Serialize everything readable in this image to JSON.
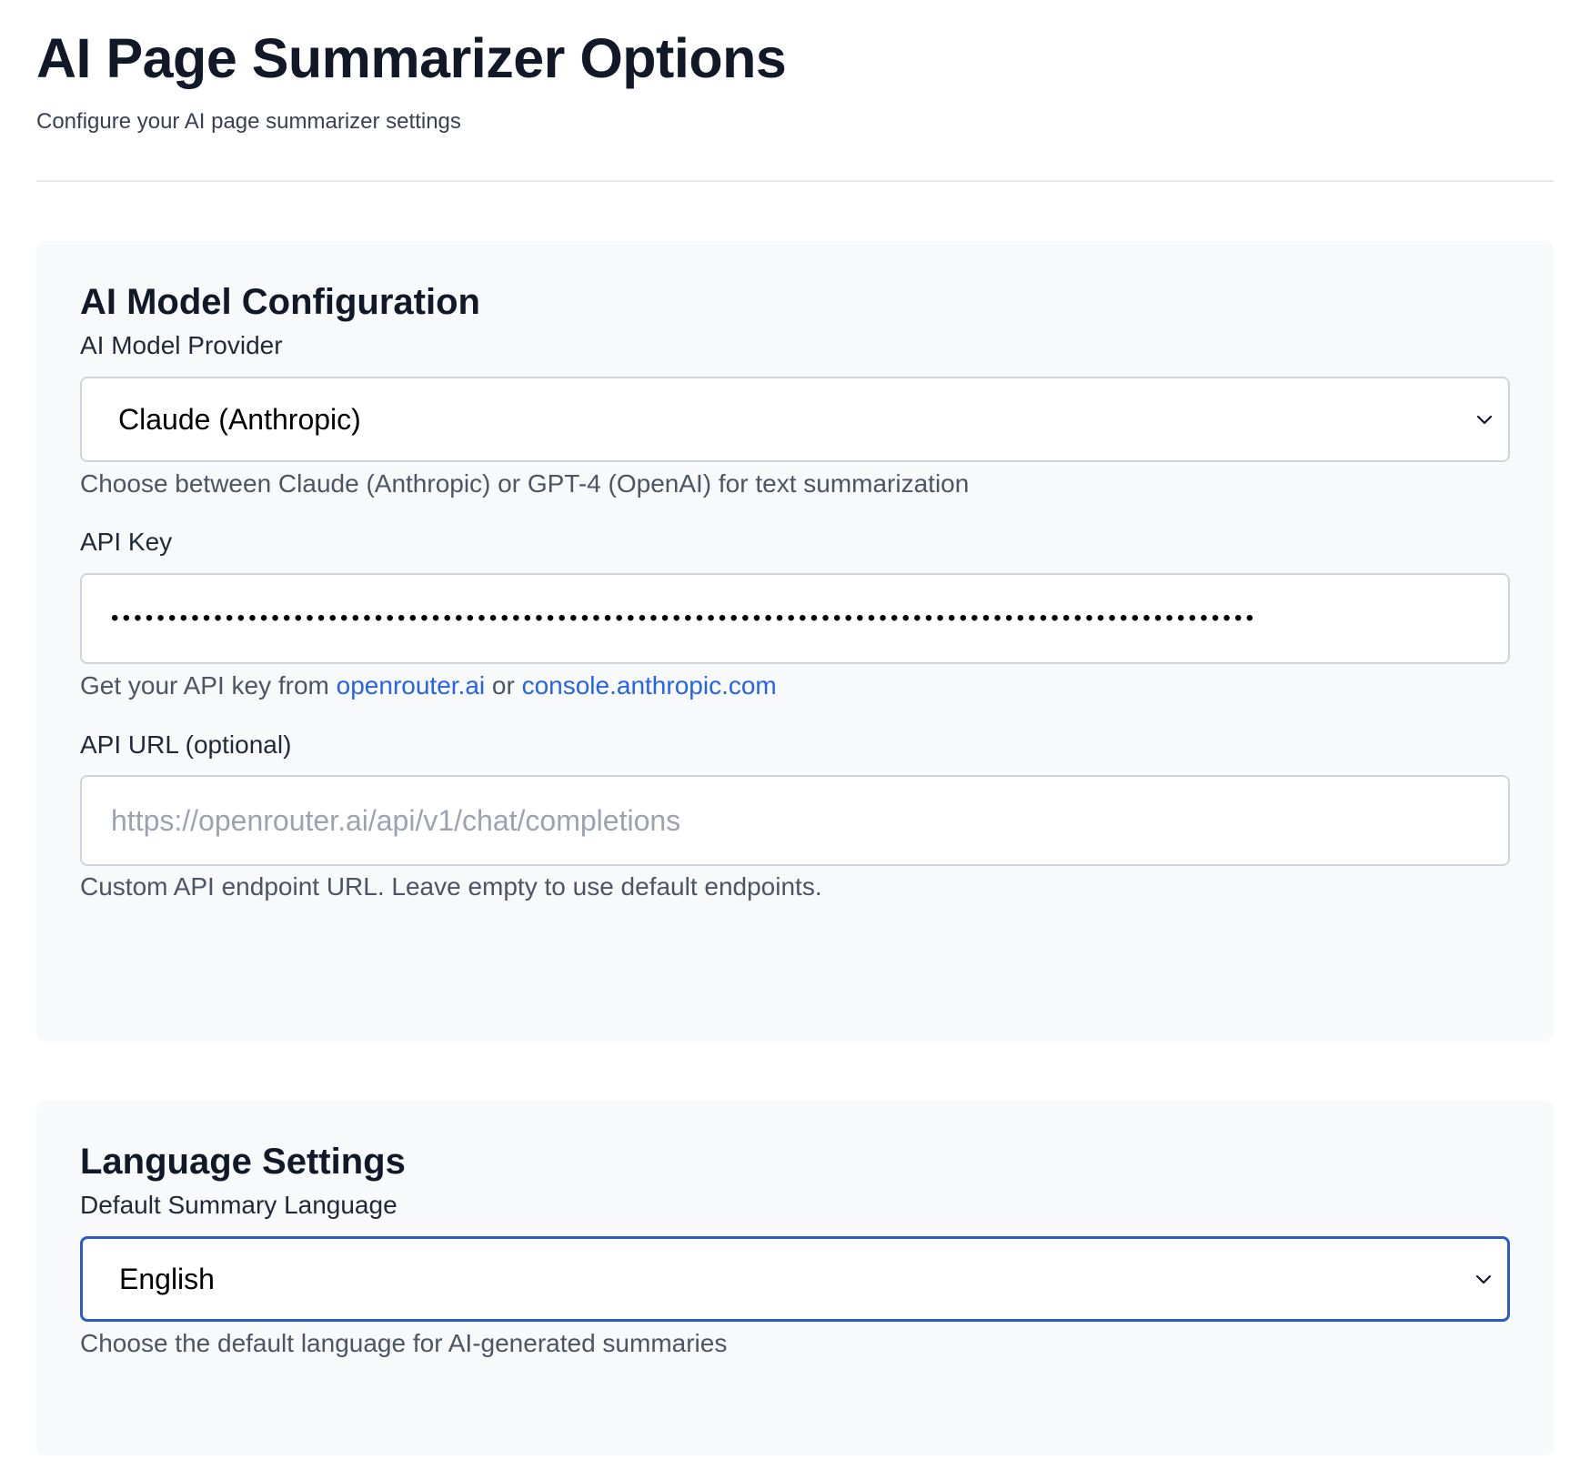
{
  "header": {
    "title": "AI Page Summarizer Options",
    "subtitle": "Configure your AI page summarizer settings"
  },
  "ai_section": {
    "title": "AI Model Configuration",
    "provider": {
      "label": "AI Model Provider",
      "selected": "Claude (Anthropic)",
      "help": "Choose between Claude (Anthropic) or GPT-4 (OpenAI) for text summarization"
    },
    "api_key": {
      "label": "API Key",
      "masked_value": "••••••••••••••••••••••••••••••••••••••••••••••••••••••••••••••••••••••••••••••••••••••••••••••••••••",
      "help_prefix": "Get your API key from ",
      "link1": "openrouter.ai",
      "help_middle": " or ",
      "link2": "console.anthropic.com"
    },
    "api_url": {
      "label": "API URL (optional)",
      "placeholder": "https://openrouter.ai/api/v1/chat/completions",
      "help": "Custom API endpoint URL. Leave empty to use default endpoints."
    }
  },
  "language_section": {
    "title": "Language Settings",
    "default_language": {
      "label": "Default Summary Language",
      "selected": "English",
      "help": "Choose the default language for AI-generated summaries"
    }
  },
  "colors": {
    "link": "#2563eb",
    "focus_border": "#2b5bc4",
    "section_bg": "#f8f9fb"
  },
  "icons": {
    "select_arrow": "chevron-down-icon"
  }
}
